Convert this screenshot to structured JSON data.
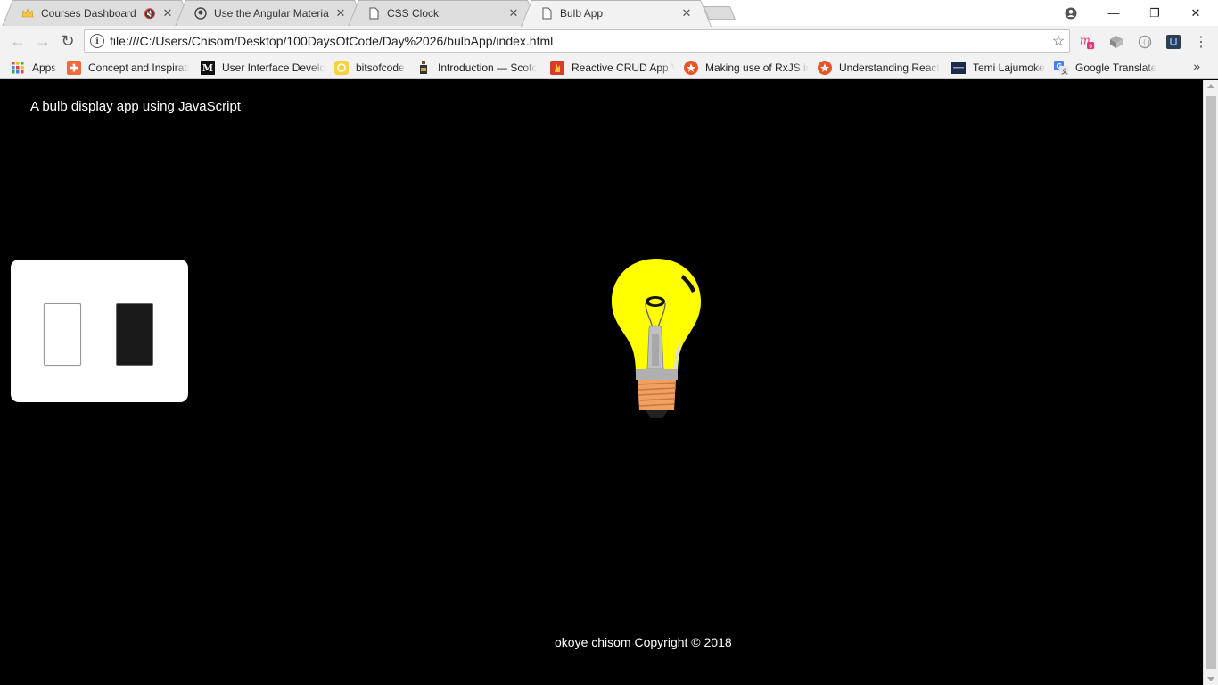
{
  "browser": {
    "tabs": [
      {
        "title": "Courses Dashboard | V",
        "favicon": "crown-icon",
        "muted": true
      },
      {
        "title": "Use the Angular Materia",
        "favicon": "github-icon"
      },
      {
        "title": "CSS Clock",
        "favicon": "page-icon"
      },
      {
        "title": "Bulb App",
        "favicon": "page-icon",
        "active": true
      }
    ],
    "close_glyph": "✕",
    "window_controls": {
      "minimize": "—",
      "restore": "❐",
      "close": "✕"
    },
    "url": "file:///C:/Users/Chisom/Desktop/100DaysOfCode/Day%2026/bulbApp/index.html",
    "bookmarks": [
      {
        "label": "Apps",
        "icon": "apps-grid-icon"
      },
      {
        "label": "Concept and Inspirati",
        "icon": "plus-square-icon"
      },
      {
        "label": "User Interface Develc",
        "icon": "medium-icon"
      },
      {
        "label": "bitsofcode",
        "icon": "bitsofcode-icon"
      },
      {
        "label": "Introduction — Scotc",
        "icon": "scotch-icon"
      },
      {
        "label": "Reactive CRUD App V",
        "icon": "firebase-icon"
      },
      {
        "label": "Making use of RxJS ir",
        "icon": "auth0-icon"
      },
      {
        "label": "Understanding React",
        "icon": "auth0-icon"
      },
      {
        "label": "Temi Lajumoke",
        "icon": "site-icon"
      },
      {
        "label": "Google Translate",
        "icon": "translate-icon"
      }
    ],
    "bookmarks_more": "»"
  },
  "page": {
    "heading": "A bulb display app using JavaScript",
    "footer": "okoye chisom Copyright © 2018",
    "bulb_state": "on",
    "colors": {
      "background": "#000000",
      "bulb": "#ffff00",
      "base": "#f0a060"
    }
  }
}
